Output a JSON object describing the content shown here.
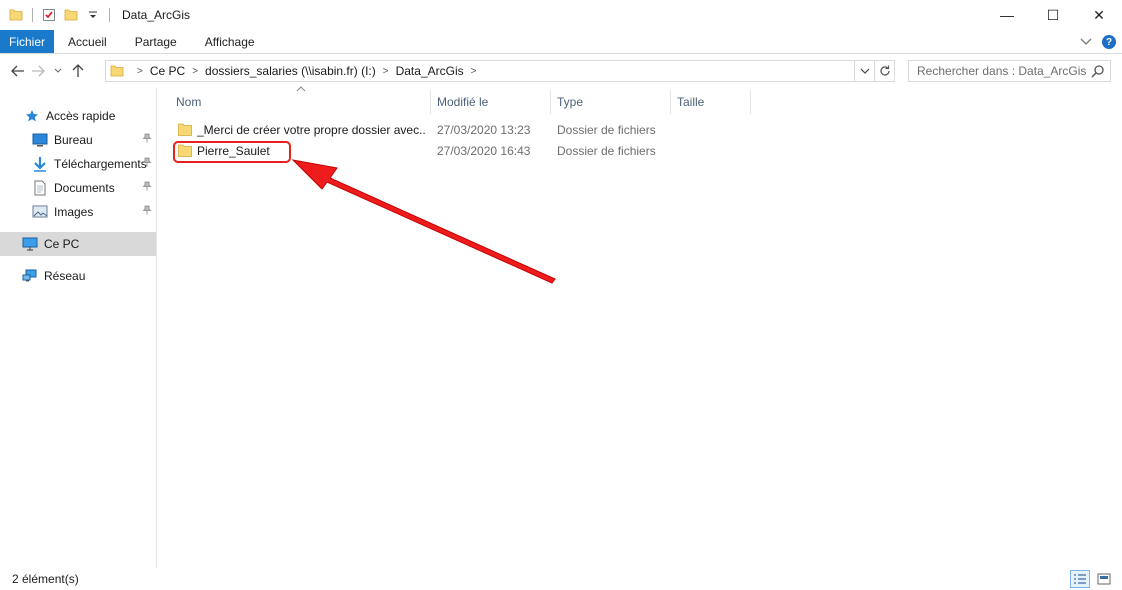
{
  "window": {
    "title": "Data_ArcGis",
    "minimize": "—",
    "maximize": "☐",
    "close": "✕"
  },
  "ribbon": {
    "tabs": [
      "Fichier",
      "Accueil",
      "Partage",
      "Affichage"
    ],
    "expand_icon": "chevron-down-icon",
    "help_label": "?"
  },
  "address": {
    "breadcrumbs": [
      "Ce PC",
      "dossiers_salaries (\\\\isabin.fr) (I:)",
      "Data_ArcGis"
    ],
    "search_placeholder": "Rechercher dans : Data_ArcGis"
  },
  "nav_pane": {
    "items": [
      {
        "label": "Accès rapide",
        "icon": "star-icon"
      },
      {
        "label": "Bureau",
        "icon": "desktop-icon",
        "pinned": true
      },
      {
        "label": "Téléchargements",
        "icon": "download-icon",
        "pinned": true
      },
      {
        "label": "Documents",
        "icon": "documents-icon",
        "pinned": true
      },
      {
        "label": "Images",
        "icon": "images-icon",
        "pinned": true
      },
      {
        "label": "Ce PC",
        "icon": "computer-icon",
        "selected": true
      },
      {
        "label": "Réseau",
        "icon": "network-icon"
      }
    ]
  },
  "columns": [
    "Nom",
    "Modifié le",
    "Type",
    "Taille"
  ],
  "files": [
    {
      "name": "_Merci de créer votre propre dossier avec...",
      "modified": "27/03/2020 13:23",
      "type": "Dossier de fichiers",
      "size": ""
    },
    {
      "name": "Pierre_Saulet",
      "modified": "27/03/2020 16:43",
      "type": "Dossier de fichiers",
      "size": ""
    }
  ],
  "annotation": {
    "color": "#e82020"
  },
  "status": {
    "item_count": "2 élément(s)"
  },
  "colors": {
    "accent": "#1979ca",
    "folder": "#f8d775",
    "header_text": "#4c607a"
  }
}
